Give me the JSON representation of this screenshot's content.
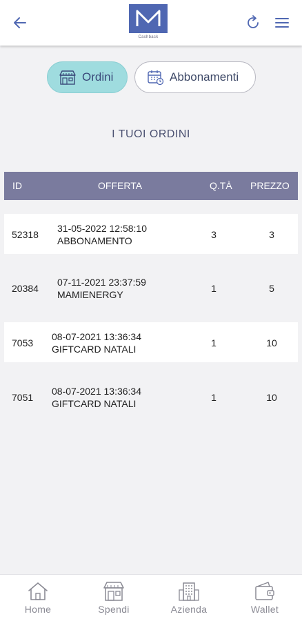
{
  "header": {
    "logo_text": "Cashback",
    "back_icon": "arrow-left-icon",
    "refresh_icon": "refresh-icon",
    "menu_icon": "hamburger-menu-icon",
    "accent_color": "#4f67b2"
  },
  "tabs": [
    {
      "label": "Ordini",
      "active": true,
      "icon": "store-icon"
    },
    {
      "label": "Abbonamenti",
      "active": false,
      "icon": "calendar-icon"
    }
  ],
  "section_title": "I TUOI ORDINI",
  "table": {
    "headers": {
      "id": "ID",
      "offerta": "OFFERTA",
      "qta": "Q.TÀ",
      "prezzo": "PREZZO"
    },
    "rows": [
      {
        "id": "52318",
        "date": "31-05-2022 12:58:10",
        "name": "ABBONAMENTO",
        "qty": "3",
        "price": "3"
      },
      {
        "id": "20384",
        "date": "07-11-2021 23:37:59",
        "name": "MAMIENERGY",
        "qty": "1",
        "price": "5"
      },
      {
        "id": "7053",
        "date": "08-07-2021 13:36:34",
        "name": "GIFTCARD NATALI",
        "qty": "1",
        "price": "10"
      },
      {
        "id": "7051",
        "date": "08-07-2021 13:36:34",
        "name": "GIFTCARD NATALI",
        "qty": "1",
        "price": "10"
      }
    ]
  },
  "bottom_nav": [
    {
      "label": "Home",
      "icon": "home-icon"
    },
    {
      "label": "Spendi",
      "icon": "shop-icon"
    },
    {
      "label": "Azienda",
      "icon": "building-icon"
    },
    {
      "label": "Wallet",
      "icon": "wallet-icon"
    }
  ]
}
